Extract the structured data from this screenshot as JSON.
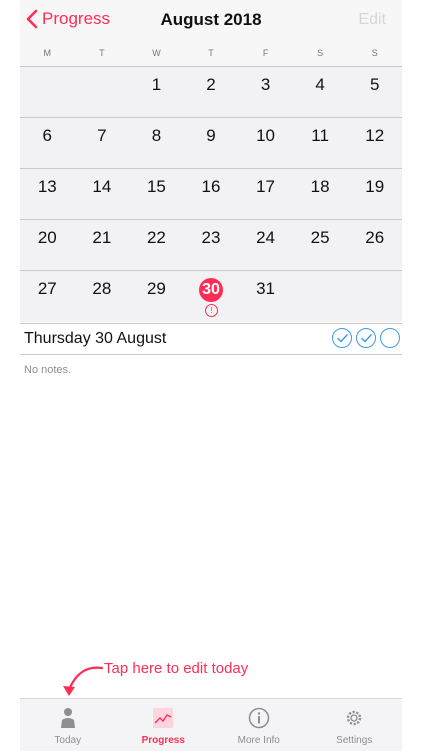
{
  "header": {
    "back_label": "Progress",
    "title": "August 2018",
    "edit_label": "Edit"
  },
  "weekdays": [
    "M",
    "T",
    "W",
    "T",
    "F",
    "S",
    "S"
  ],
  "calendar": {
    "rows": [
      [
        "",
        "",
        "1",
        "2",
        "3",
        "4",
        "5"
      ],
      [
        "6",
        "7",
        "8",
        "9",
        "10",
        "11",
        "12"
      ],
      [
        "13",
        "14",
        "15",
        "16",
        "17",
        "18",
        "19"
      ],
      [
        "20",
        "21",
        "22",
        "23",
        "24",
        "25",
        "26"
      ],
      [
        "27",
        "28",
        "29",
        "30",
        "31",
        "",
        ""
      ]
    ],
    "today": "30"
  },
  "selected": {
    "date_label": "Thursday 30 August",
    "checks": [
      true,
      true,
      false
    ]
  },
  "notes": {
    "text": "No notes."
  },
  "annotation": {
    "text": "Tap here to edit today"
  },
  "tabs": [
    {
      "label": "Today",
      "icon": "person-icon",
      "active": false
    },
    {
      "label": "Progress",
      "icon": "chart-icon",
      "active": true
    },
    {
      "label": "More Info",
      "icon": "info-icon",
      "active": false
    },
    {
      "label": "Settings",
      "icon": "gear-icon",
      "active": false
    }
  ],
  "colors": {
    "accent": "#ff2d55",
    "check": "#3d9be9"
  }
}
